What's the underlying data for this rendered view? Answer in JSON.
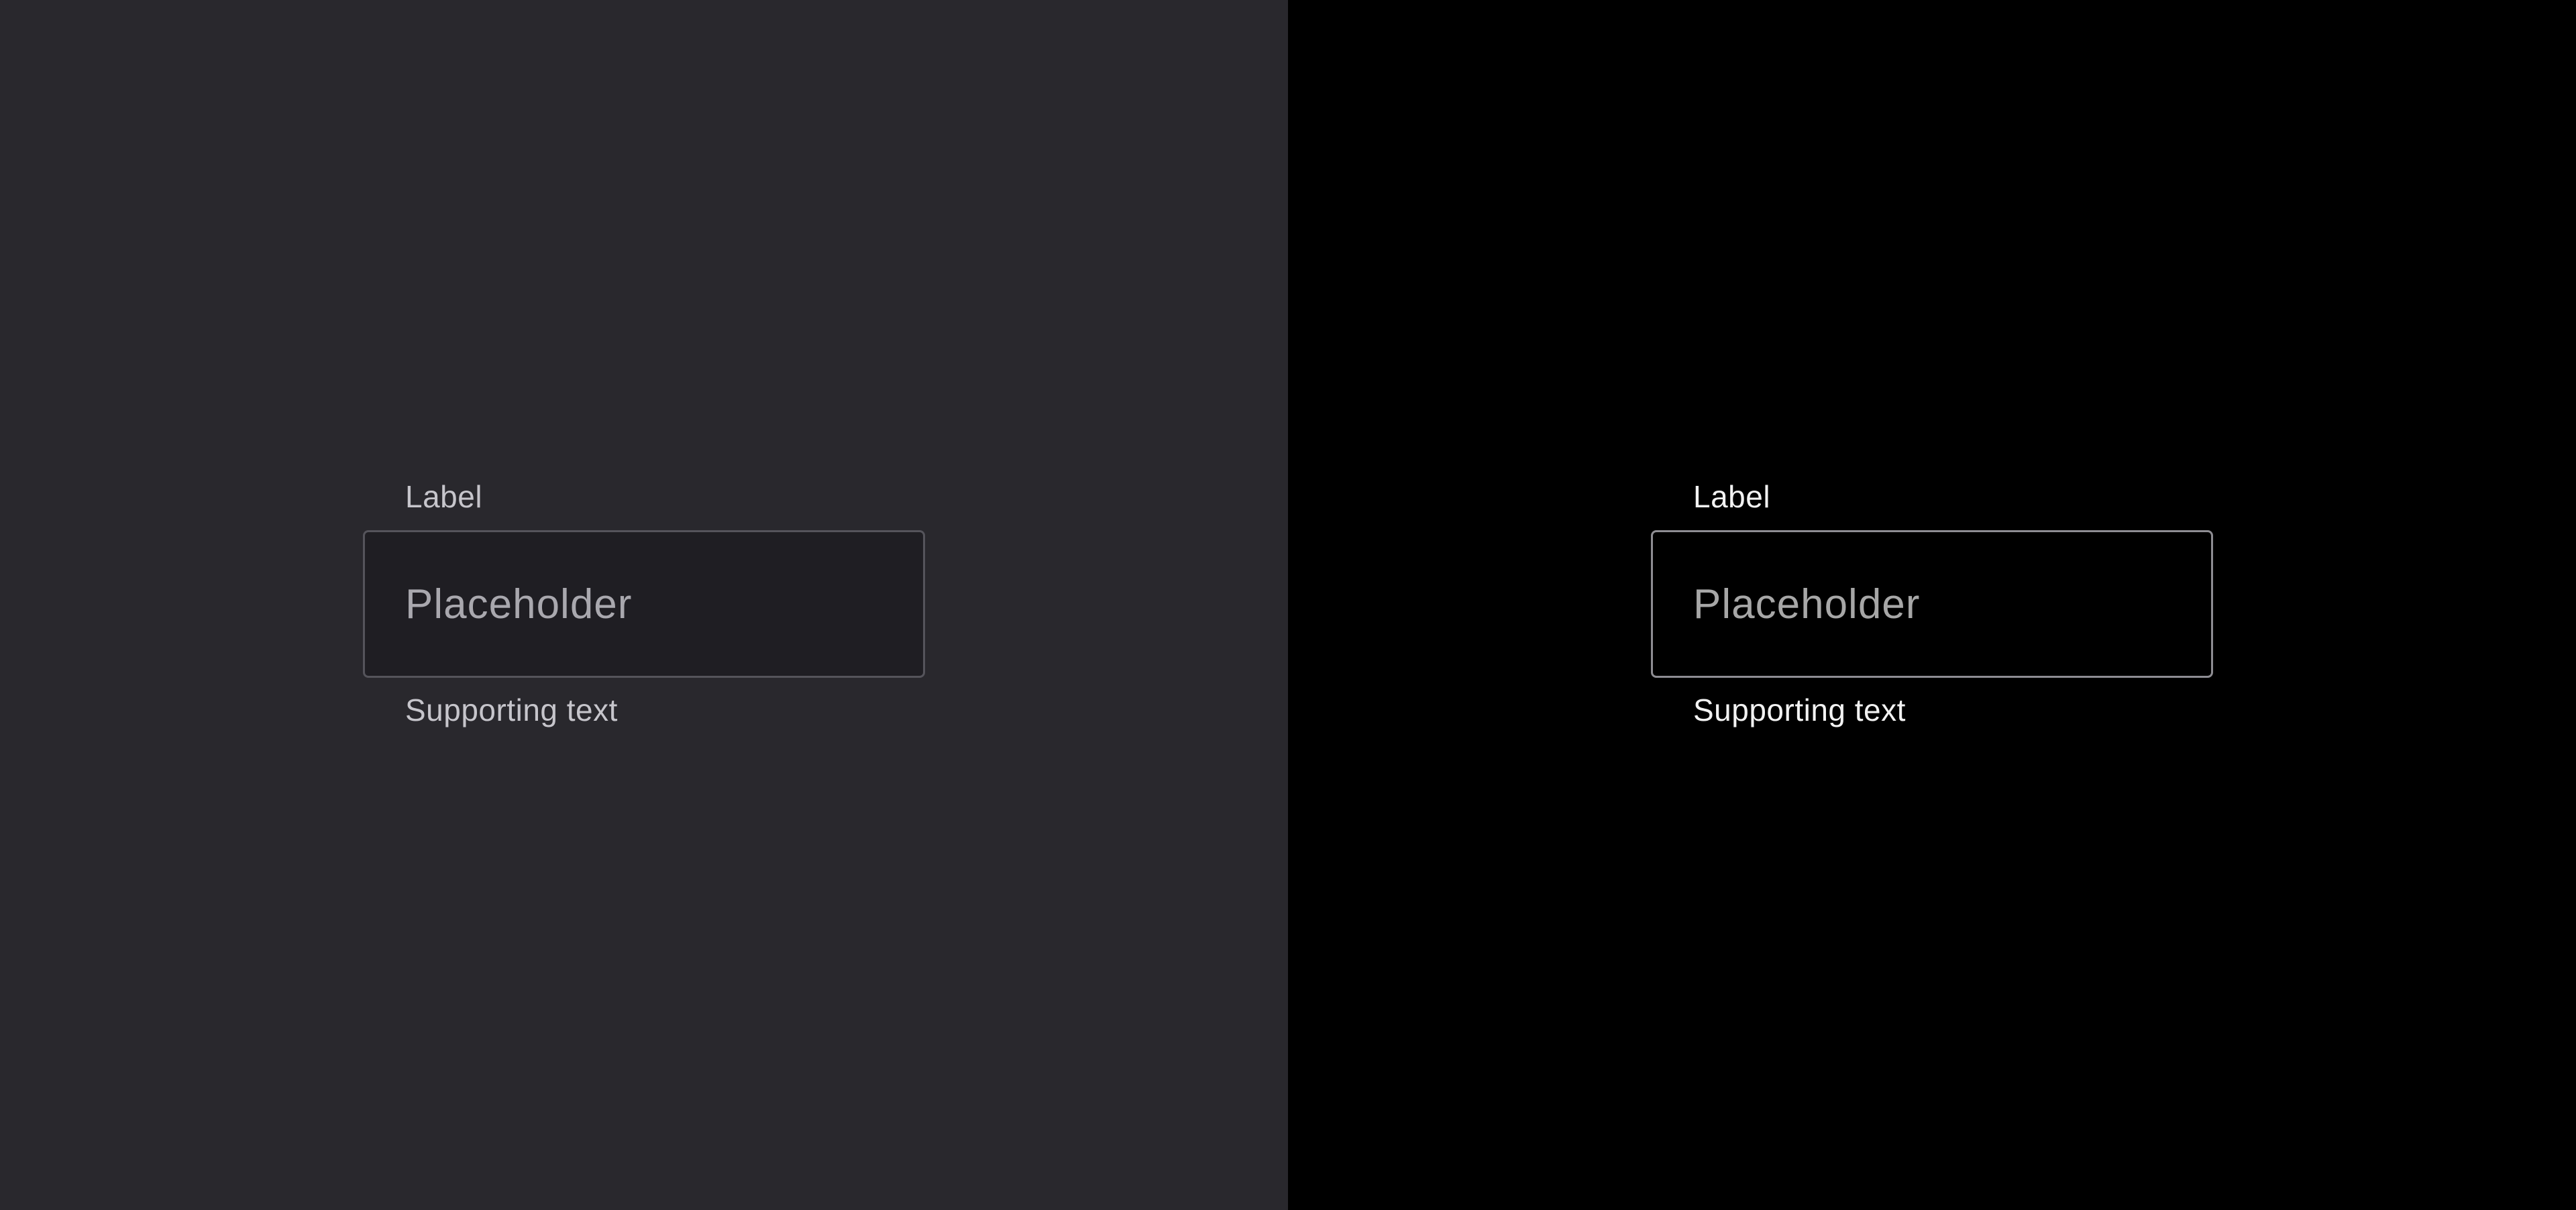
{
  "panels": [
    {
      "theme": "standard-dark",
      "background": "#29282d",
      "field": {
        "label": "Label",
        "placeholder": "Placeholder",
        "value": "",
        "supporting_text": "Supporting text"
      }
    },
    {
      "theme": "high-contrast-dark",
      "background": "#000000",
      "field": {
        "label": "Label",
        "placeholder": "Placeholder",
        "value": "",
        "supporting_text": "Supporting text"
      }
    }
  ]
}
